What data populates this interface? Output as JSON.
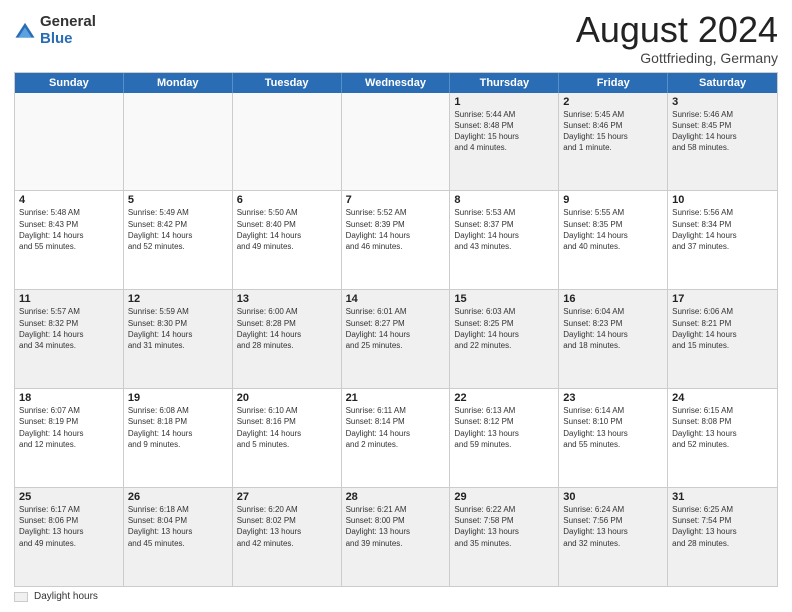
{
  "header": {
    "logo_general": "General",
    "logo_blue": "Blue",
    "month_title": "August 2024",
    "location": "Gottfrieding, Germany"
  },
  "calendar": {
    "weekdays": [
      "Sunday",
      "Monday",
      "Tuesday",
      "Wednesday",
      "Thursday",
      "Friday",
      "Saturday"
    ],
    "rows": [
      [
        {
          "day": "",
          "text": ""
        },
        {
          "day": "",
          "text": ""
        },
        {
          "day": "",
          "text": ""
        },
        {
          "day": "",
          "text": ""
        },
        {
          "day": "1",
          "text": "Sunrise: 5:44 AM\nSunset: 8:48 PM\nDaylight: 15 hours\nand 4 minutes."
        },
        {
          "day": "2",
          "text": "Sunrise: 5:45 AM\nSunset: 8:46 PM\nDaylight: 15 hours\nand 1 minute."
        },
        {
          "day": "3",
          "text": "Sunrise: 5:46 AM\nSunset: 8:45 PM\nDaylight: 14 hours\nand 58 minutes."
        }
      ],
      [
        {
          "day": "4",
          "text": "Sunrise: 5:48 AM\nSunset: 8:43 PM\nDaylight: 14 hours\nand 55 minutes."
        },
        {
          "day": "5",
          "text": "Sunrise: 5:49 AM\nSunset: 8:42 PM\nDaylight: 14 hours\nand 52 minutes."
        },
        {
          "day": "6",
          "text": "Sunrise: 5:50 AM\nSunset: 8:40 PM\nDaylight: 14 hours\nand 49 minutes."
        },
        {
          "day": "7",
          "text": "Sunrise: 5:52 AM\nSunset: 8:39 PM\nDaylight: 14 hours\nand 46 minutes."
        },
        {
          "day": "8",
          "text": "Sunrise: 5:53 AM\nSunset: 8:37 PM\nDaylight: 14 hours\nand 43 minutes."
        },
        {
          "day": "9",
          "text": "Sunrise: 5:55 AM\nSunset: 8:35 PM\nDaylight: 14 hours\nand 40 minutes."
        },
        {
          "day": "10",
          "text": "Sunrise: 5:56 AM\nSunset: 8:34 PM\nDaylight: 14 hours\nand 37 minutes."
        }
      ],
      [
        {
          "day": "11",
          "text": "Sunrise: 5:57 AM\nSunset: 8:32 PM\nDaylight: 14 hours\nand 34 minutes."
        },
        {
          "day": "12",
          "text": "Sunrise: 5:59 AM\nSunset: 8:30 PM\nDaylight: 14 hours\nand 31 minutes."
        },
        {
          "day": "13",
          "text": "Sunrise: 6:00 AM\nSunset: 8:28 PM\nDaylight: 14 hours\nand 28 minutes."
        },
        {
          "day": "14",
          "text": "Sunrise: 6:01 AM\nSunset: 8:27 PM\nDaylight: 14 hours\nand 25 minutes."
        },
        {
          "day": "15",
          "text": "Sunrise: 6:03 AM\nSunset: 8:25 PM\nDaylight: 14 hours\nand 22 minutes."
        },
        {
          "day": "16",
          "text": "Sunrise: 6:04 AM\nSunset: 8:23 PM\nDaylight: 14 hours\nand 18 minutes."
        },
        {
          "day": "17",
          "text": "Sunrise: 6:06 AM\nSunset: 8:21 PM\nDaylight: 14 hours\nand 15 minutes."
        }
      ],
      [
        {
          "day": "18",
          "text": "Sunrise: 6:07 AM\nSunset: 8:19 PM\nDaylight: 14 hours\nand 12 minutes."
        },
        {
          "day": "19",
          "text": "Sunrise: 6:08 AM\nSunset: 8:18 PM\nDaylight: 14 hours\nand 9 minutes."
        },
        {
          "day": "20",
          "text": "Sunrise: 6:10 AM\nSunset: 8:16 PM\nDaylight: 14 hours\nand 5 minutes."
        },
        {
          "day": "21",
          "text": "Sunrise: 6:11 AM\nSunset: 8:14 PM\nDaylight: 14 hours\nand 2 minutes."
        },
        {
          "day": "22",
          "text": "Sunrise: 6:13 AM\nSunset: 8:12 PM\nDaylight: 13 hours\nand 59 minutes."
        },
        {
          "day": "23",
          "text": "Sunrise: 6:14 AM\nSunset: 8:10 PM\nDaylight: 13 hours\nand 55 minutes."
        },
        {
          "day": "24",
          "text": "Sunrise: 6:15 AM\nSunset: 8:08 PM\nDaylight: 13 hours\nand 52 minutes."
        }
      ],
      [
        {
          "day": "25",
          "text": "Sunrise: 6:17 AM\nSunset: 8:06 PM\nDaylight: 13 hours\nand 49 minutes."
        },
        {
          "day": "26",
          "text": "Sunrise: 6:18 AM\nSunset: 8:04 PM\nDaylight: 13 hours\nand 45 minutes."
        },
        {
          "day": "27",
          "text": "Sunrise: 6:20 AM\nSunset: 8:02 PM\nDaylight: 13 hours\nand 42 minutes."
        },
        {
          "day": "28",
          "text": "Sunrise: 6:21 AM\nSunset: 8:00 PM\nDaylight: 13 hours\nand 39 minutes."
        },
        {
          "day": "29",
          "text": "Sunrise: 6:22 AM\nSunset: 7:58 PM\nDaylight: 13 hours\nand 35 minutes."
        },
        {
          "day": "30",
          "text": "Sunrise: 6:24 AM\nSunset: 7:56 PM\nDaylight: 13 hours\nand 32 minutes."
        },
        {
          "day": "31",
          "text": "Sunrise: 6:25 AM\nSunset: 7:54 PM\nDaylight: 13 hours\nand 28 minutes."
        }
      ]
    ]
  },
  "footer": {
    "legend_label": "Daylight hours"
  }
}
